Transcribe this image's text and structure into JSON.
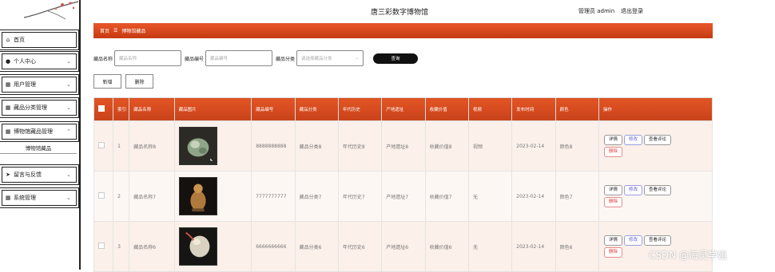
{
  "app": {
    "title": "唐三彩数字博物馆",
    "admin_label": "管理员 admin",
    "logout_label": "退出登录"
  },
  "sidebar": {
    "items": [
      {
        "label": "首页",
        "icon": "home-icon",
        "chevron": ""
      },
      {
        "label": "个人中心",
        "icon": "user-icon",
        "chevron": "⌄"
      },
      {
        "label": "用户管理",
        "icon": "grid-icon",
        "chevron": "⌄"
      },
      {
        "label": "藏品分类管理",
        "icon": "grid-icon",
        "chevron": "⌄"
      },
      {
        "label": "博物馆藏品管理",
        "icon": "grid-icon",
        "chevron": "⌃"
      }
    ],
    "sub_item": "博物馆藏品",
    "items2": [
      {
        "label": "留言与反馈",
        "icon": "send-icon",
        "chevron": "⌄"
      },
      {
        "label": "系统管理",
        "icon": "grid-icon",
        "chevron": "⌄"
      }
    ]
  },
  "breadcrumb": {
    "home": "首页",
    "sep": "☰",
    "current": "博物馆藏品"
  },
  "search": {
    "name_label": "藏品名称",
    "name_placeholder": "藏品名称",
    "code_label": "藏品编号",
    "code_placeholder": "藏品编号",
    "cat_label": "藏品分类",
    "cat_placeholder": "请选择藏品分类",
    "cat_arrow": "⌄",
    "query_label": "查询"
  },
  "actions": {
    "add_label": "新增",
    "delete_label": "删除"
  },
  "table": {
    "headers": [
      "",
      "索引",
      "藏品名称",
      "藏品图片",
      "藏品编号",
      "藏品分类",
      "年代历史",
      "产地遗址",
      "收藏价值",
      "视频",
      "发布时间",
      "颜色",
      "操作"
    ],
    "rows": [
      {
        "index": "1",
        "name": "藏品名称8",
        "code": "8888888888",
        "category": "藏品分类8",
        "era": "年代历史8",
        "origin": "产地遗址8",
        "value": "收藏价值8",
        "video": "视频",
        "date": "2023-02-14",
        "color": "颜色8"
      },
      {
        "index": "2",
        "name": "藏品名称7",
        "code": "7777777777",
        "category": "藏品分类7",
        "era": "年代历史7",
        "origin": "产地遗址7",
        "value": "收藏价值7",
        "video": "无",
        "date": "2023-02-14",
        "color": "颜色7"
      },
      {
        "index": "3",
        "name": "藏品名称6",
        "code": "6666666666",
        "category": "藏品分类6",
        "era": "年代历史6",
        "origin": "产地遗址6",
        "value": "收藏价值6",
        "video": "无",
        "date": "2023-02-14",
        "color": "颜色6"
      }
    ],
    "row_actions": {
      "detail": "详情",
      "edit": "修改",
      "comments": "查看评论",
      "delete": "删除"
    }
  },
  "watermark": "CSDN @海灵学姐",
  "colors": {
    "accent": "#d9491f",
    "header_bg": "#e35424",
    "row_bg": "#fbf0ea"
  }
}
